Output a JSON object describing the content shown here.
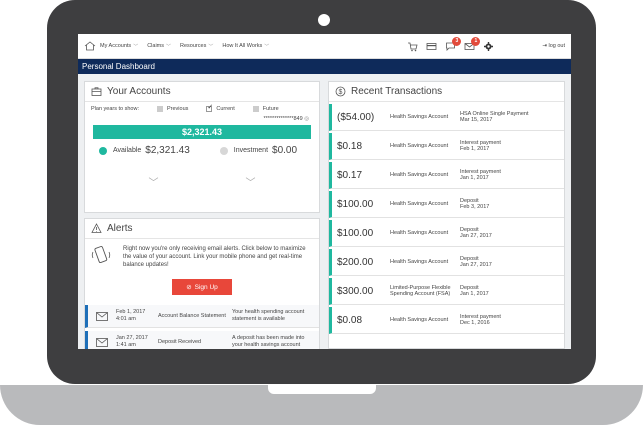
{
  "nav": {
    "items": [
      "My Accounts",
      "Claims",
      "Resources",
      "How It All Works"
    ],
    "badge_messages": "3",
    "badge_mail": "1",
    "logout": "log out"
  },
  "title_bar": "Personal Dashboard",
  "accounts": {
    "heading": "Your Accounts",
    "plan_years_label": "Plan years to show:",
    "opt_previous": "Previous",
    "opt_current": "Current",
    "opt_future": "Future",
    "account_number": "**************849",
    "balance": "$2,321.43",
    "available_label": "Available",
    "available_value": "$2,321.43",
    "investment_label": "Investment",
    "investment_value": "$0.00",
    "available_color": "#1fb89f",
    "investment_color": "#d7d7d7"
  },
  "alerts": {
    "heading": "Alerts",
    "message": "Right now you're only receiving email alerts. Click below to maximize the value of your account. Link your mobile phone and get real-time balance updates!",
    "signup_label": "Sign Up",
    "rows": [
      {
        "date": "Feb 1, 2017",
        "time": "4:01 am",
        "type": "Account Balance Statement",
        "text": "Your health spending account statement is available"
      },
      {
        "date": "Jan 27, 2017",
        "time": "1:41 am",
        "type": "Deposit Received",
        "text": "A deposit has been made into your health savings account"
      }
    ]
  },
  "transactions": {
    "heading": "Recent Transactions",
    "rows": [
      {
        "amount": "($54.00)",
        "account": "Health Savings Account",
        "desc": "HSA Online Single Payment",
        "date": "Mar 15, 2017"
      },
      {
        "amount": "$0.18",
        "account": "Health Savings Account",
        "desc": "Interest payment",
        "date": "Feb 1, 2017"
      },
      {
        "amount": "$0.17",
        "account": "Health Savings Account",
        "desc": "Interest payment",
        "date": "Jan 1, 2017"
      },
      {
        "amount": "$100.00",
        "account": "Health Savings Account",
        "desc": "Deposit",
        "date": "Feb 3, 2017"
      },
      {
        "amount": "$100.00",
        "account": "Health Savings Account",
        "desc": "Deposit",
        "date": "Jan 27, 2017"
      },
      {
        "amount": "$200.00",
        "account": "Health Savings Account",
        "desc": "Deposit",
        "date": "Jan 27, 2017"
      },
      {
        "amount": "$300.00",
        "account": "Limited-Purpose Flexible Spending Account (FSA)",
        "desc": "Deposit",
        "date": "Jan 1, 2017"
      },
      {
        "amount": "$0.08",
        "account": "Health Savings Account",
        "desc": "Interest payment",
        "date": "Dec 1, 2016"
      }
    ]
  },
  "colors": {
    "nav_bar": "#0e2a5a",
    "accent_green": "#1fb89f",
    "accent_red": "#e8473a",
    "alert_blue": "#1e6fb8"
  }
}
